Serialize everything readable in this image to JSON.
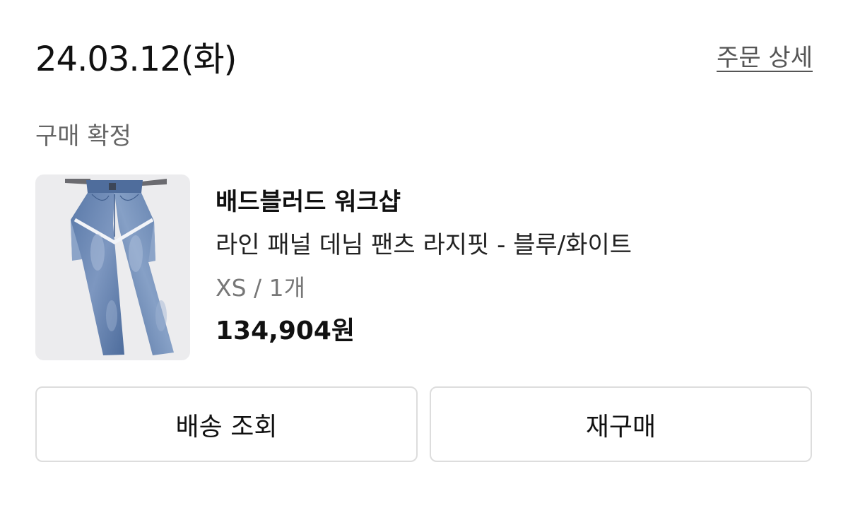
{
  "order": {
    "date": "24.03.12(화)",
    "detail_link": "주문 상세",
    "status": "구매 확정"
  },
  "product": {
    "brand": "배드블러드 워크샵",
    "name": "라인 패널 데님 팬츠 라지핏 - 블루/화이트",
    "option": "XS / 1개",
    "price": "134,904원",
    "thumbnail_icon": "denim-pants-image"
  },
  "actions": {
    "track_label": "배송 조회",
    "rebuy_label": "재구매"
  }
}
